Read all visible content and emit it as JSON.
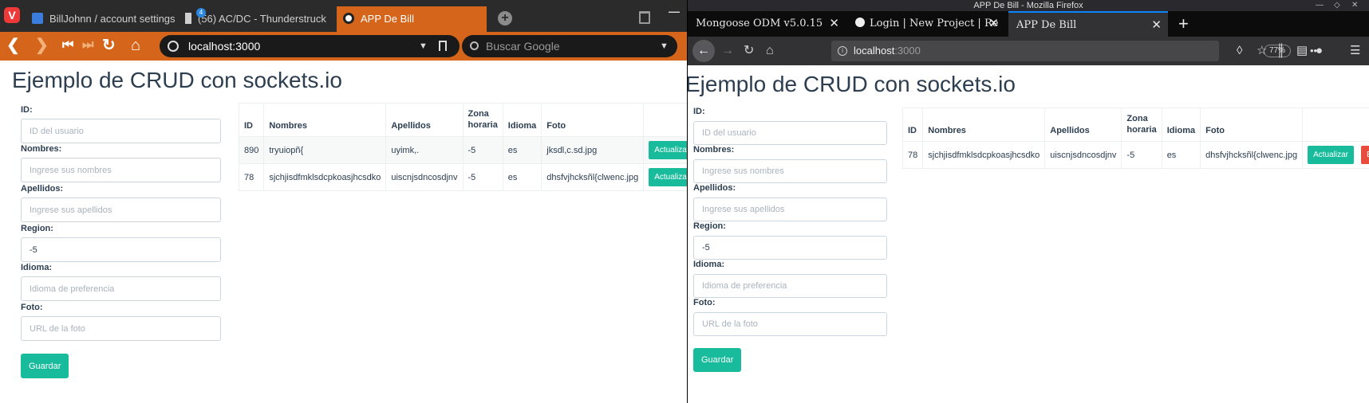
{
  "vivaldi": {
    "tabs": [
      {
        "label": "BillJohnn / account settings"
      },
      {
        "label": "(56) AC/DC - Thunderstruck"
      },
      {
        "label": "APP De Bill"
      }
    ],
    "audio_badge": "4",
    "url": "localhost:3000",
    "search_placeholder": "Buscar Google"
  },
  "firefox": {
    "window_title": "APP De Bill - Mozilla Firefox",
    "tabs": [
      {
        "label": "Mongoose ODM v5.0.15"
      },
      {
        "label": "Login | New Project | Re"
      },
      {
        "label": "APP De Bill"
      }
    ],
    "url_host": "localhost",
    "url_port": ":3000",
    "zoom": "77%"
  },
  "page": {
    "title": "Ejemplo de CRUD con sockets.io",
    "form": {
      "id_label": "ID:",
      "id_placeholder": "ID del usuario",
      "names_label": "Nombres:",
      "names_placeholder": "Ingrese sus nombres",
      "surnames_label": "Apellidos:",
      "surnames_placeholder": "Ingrese sus apellidos",
      "region_label": "Region:",
      "region_value": "-5",
      "language_label": "Idioma:",
      "language_placeholder": "Idioma de preferencia",
      "photo_label": "Foto:",
      "photo_placeholder": "URL de la foto",
      "save_label": "Guardar"
    },
    "table": {
      "headers": [
        "ID",
        "Nombres",
        "Apellidos",
        "Zona horaria",
        "Idioma",
        "Foto"
      ],
      "update_label": "Actualizar",
      "delete_label": "Elim"
    },
    "left_rows": [
      {
        "id": "890",
        "names": "tryuiopñ{",
        "surnames": "uyimk,.",
        "tz": "-5",
        "lang": "es",
        "photo": "jksdl,c.sd.jpg"
      },
      {
        "id": "78",
        "names": "sjchjisdfmklsdcpkoasjhcsdko",
        "surnames": "uiscnjsdncosdjnv",
        "tz": "-5",
        "lang": "es",
        "photo": "dhsfvjhcksñl{clwenc.jpg"
      }
    ],
    "right_rows": [
      {
        "id": "78",
        "names": "sjchjisdfmklsdcpkoasjhcsdko",
        "surnames": "uiscnjsdncosdjnv",
        "tz": "-5",
        "lang": "es",
        "photo": "dhsfvjhcksñl{clwenc.jpg"
      }
    ]
  }
}
